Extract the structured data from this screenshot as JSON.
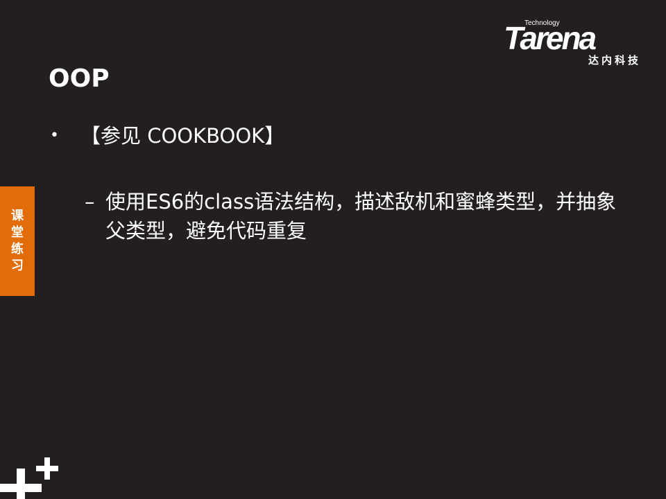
{
  "brand": {
    "technology": "Technology",
    "name": "Tarena",
    "cn_name": "达内科技"
  },
  "slide": {
    "title": "OOP",
    "bullet": "【参见 COOKBOOK】",
    "sub_dash": "–",
    "sub_text": "使用ES6的class语法结构，描述敌机和蜜蜂类型，并抽象父类型，避免代码重复"
  },
  "side_tab": {
    "chars": [
      "课",
      "堂",
      "练",
      "习"
    ]
  },
  "colors": {
    "background": "#231f20",
    "accent": "#e36c0a",
    "text": "#ffffff"
  },
  "icons": {
    "decoration": "plus-cross-icon",
    "bullet": "bullet-dot-icon"
  }
}
